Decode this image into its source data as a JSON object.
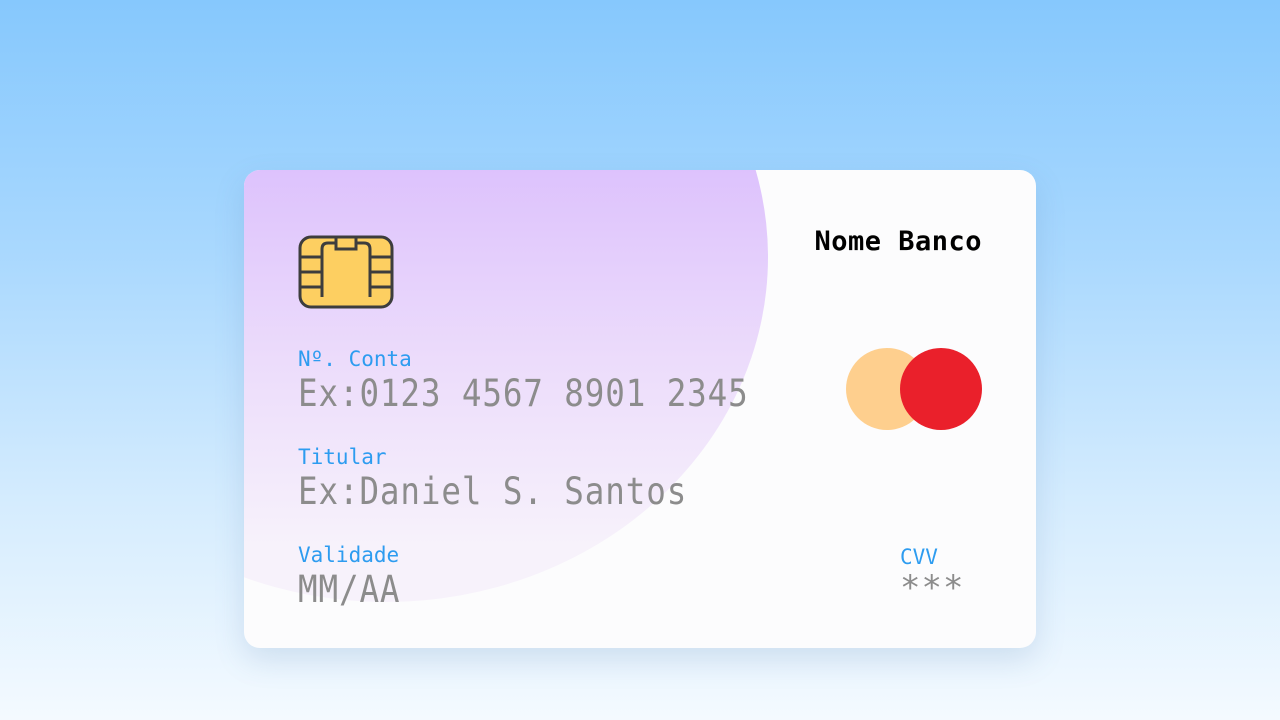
{
  "card": {
    "bank_name": "Nome Banco",
    "account": {
      "label": "Nº. Conta",
      "placeholder": "Ex:0123 4567 8901 2345"
    },
    "holder": {
      "label": "Titular",
      "placeholder": "Ex:Daniel S. Santos"
    },
    "validity": {
      "label": "Validade",
      "placeholder": "MM/AA"
    },
    "cvv": {
      "label": "CVV",
      "placeholder": "***"
    }
  },
  "icons": {
    "chip": "chip-icon",
    "card_network_logo": "card-network-logo-icon"
  },
  "colors": {
    "label_accent": "#2d9cf0",
    "chip_fill": "#fdcf61",
    "logo_left": "#fecf8e",
    "logo_right": "#ea202b",
    "blob_top": "#d3a9ff"
  }
}
